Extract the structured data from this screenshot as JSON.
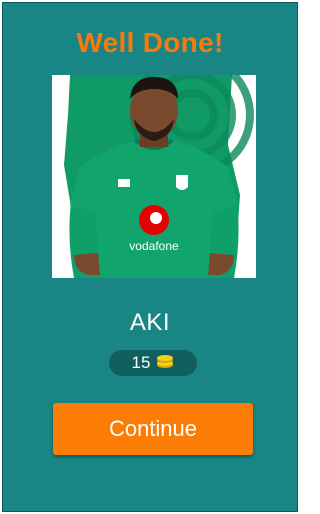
{
  "header": {
    "title": "Well Done!"
  },
  "photo": {
    "jersey_sponsor": "vodafone",
    "jersey_color": "#0f9a66"
  },
  "answer": {
    "name": "AKI"
  },
  "coins": {
    "count": "15",
    "icon": "coins-stack-icon",
    "icon_color": "#f3d21a"
  },
  "actions": {
    "continue_label": "Continue"
  },
  "colors": {
    "background": "#1a8585",
    "accent": "#f97a0b",
    "pill": "#125f5f"
  }
}
